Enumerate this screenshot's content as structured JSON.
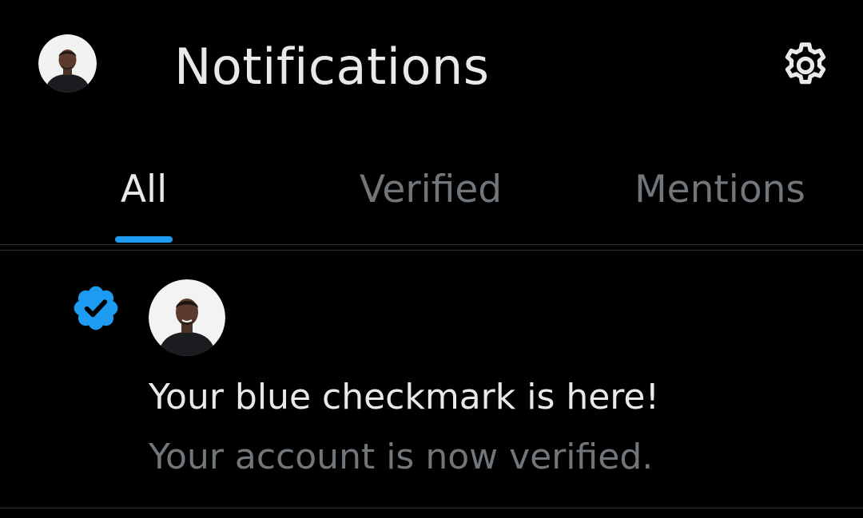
{
  "header": {
    "title": "Notifications",
    "avatar_icon": "user-avatar",
    "settings_icon": "gear-icon"
  },
  "tabs": [
    {
      "label": "All",
      "active": true
    },
    {
      "label": "Verified",
      "active": false
    },
    {
      "label": "Mentions",
      "active": false
    }
  ],
  "notification": {
    "badge_icon": "verified-badge-icon",
    "avatar_icon": "user-avatar",
    "title": "Your blue checkmark is here!",
    "subtitle": "Your account is now verified."
  },
  "colors": {
    "background": "#000000",
    "text_primary": "#e7e9ea",
    "text_secondary": "#71767b",
    "accent": "#1d9bf0",
    "divider": "#2f3336"
  }
}
